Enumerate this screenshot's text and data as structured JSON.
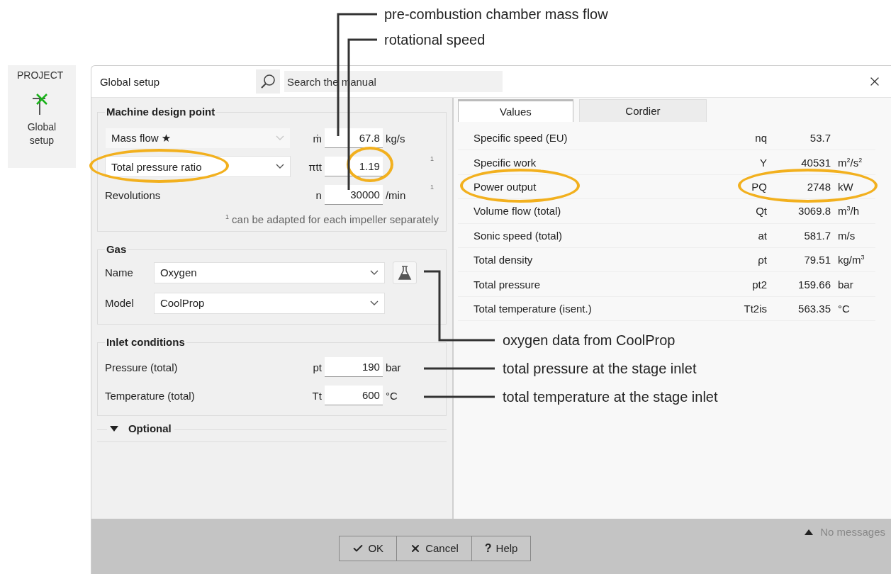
{
  "project_panel": {
    "heading": "PROJECT",
    "item": "Global setup"
  },
  "dialog": {
    "title": "Global setup",
    "search": {
      "placeholder": "Search the manual"
    }
  },
  "design_point": {
    "title": "Machine design point",
    "rows": [
      {
        "kind": "select",
        "label": "Mass flow ★",
        "disabled": true,
        "highlighted": false,
        "symbol": "ṁ",
        "value": "67.8",
        "value_highlighted": false,
        "unit": "kg/s"
      },
      {
        "kind": "select",
        "label": "Total pressure ratio",
        "disabled": false,
        "highlighted": true,
        "symbol": "πtt",
        "value": "1.19",
        "value_highlighted": true,
        "footnote": "1"
      },
      {
        "kind": "label",
        "label": "Revolutions",
        "symbol": "n",
        "value": "30000",
        "value_highlighted": false,
        "unit": "/min",
        "footnote": "1"
      }
    ],
    "note": "$^{1}$ can be adapted for each impeller separately"
  },
  "gas": {
    "title": "Gas",
    "name_label": "Name",
    "name_value": "Oxygen",
    "model_label": "Model",
    "model_value": "CoolProp"
  },
  "inlet": {
    "title": "Inlet conditions",
    "rows": [
      {
        "label": "Pressure (total)",
        "symbol": "pt",
        "value": "190",
        "unit": "bar"
      },
      {
        "label": "Temperature (total)",
        "symbol": "Tt",
        "value": "600",
        "unit": "°C"
      }
    ]
  },
  "optional": {
    "title": "Optional"
  },
  "tabs": [
    {
      "label": "Values",
      "selected": true
    },
    {
      "label": "Cordier",
      "selected": false
    }
  ],
  "results": [
    {
      "label": "Specific speed (EU)",
      "symbol": "nq",
      "value": "53.7",
      "highlighted": false
    },
    {
      "label": "Specific work",
      "symbol": "Y",
      "value": "40531",
      "unit": "m$^{2}$/s$^{2}$",
      "highlighted": false
    },
    {
      "label": "Power output",
      "symbol": "PQ",
      "value": "2748",
      "unit": "kW",
      "highlighted": true
    },
    {
      "label": "Volume flow (total)",
      "symbol": "Qt",
      "value": "3069.8",
      "unit": "m$^{3}$/h",
      "highlighted": false
    },
    {
      "label": "Sonic speed (total)",
      "symbol": "at",
      "value": "581.7",
      "unit": "m/s",
      "highlighted": false
    },
    {
      "label": "Total density",
      "symbol": "ρt",
      "value": "79.51",
      "unit": "kg/m$^{3}$",
      "highlighted": false
    },
    {
      "label": "Total pressure",
      "symbol": "pt2",
      "value": "159.66",
      "unit": "bar",
      "highlighted": false
    },
    {
      "label": "Total temperature (isent.)",
      "symbol": "Tt2is",
      "value": "563.35",
      "unit": "°C",
      "highlighted": false
    }
  ],
  "footer": {
    "buttons": [
      {
        "kind": "ok",
        "label": "OK"
      },
      {
        "kind": "cancel",
        "label": "Cancel"
      },
      {
        "kind": "help",
        "label": "Help",
        "glyph": "?"
      }
    ],
    "messages": "No messages"
  },
  "annotations": [
    {
      "text": "pre-combustion chamber mass flow"
    },
    {
      "text": "rotational speed"
    },
    {
      "text": "oxygen data from CoolProp"
    },
    {
      "text": "total pressure at the stage inlet"
    },
    {
      "text": "total temperature at the stage inlet"
    }
  ]
}
